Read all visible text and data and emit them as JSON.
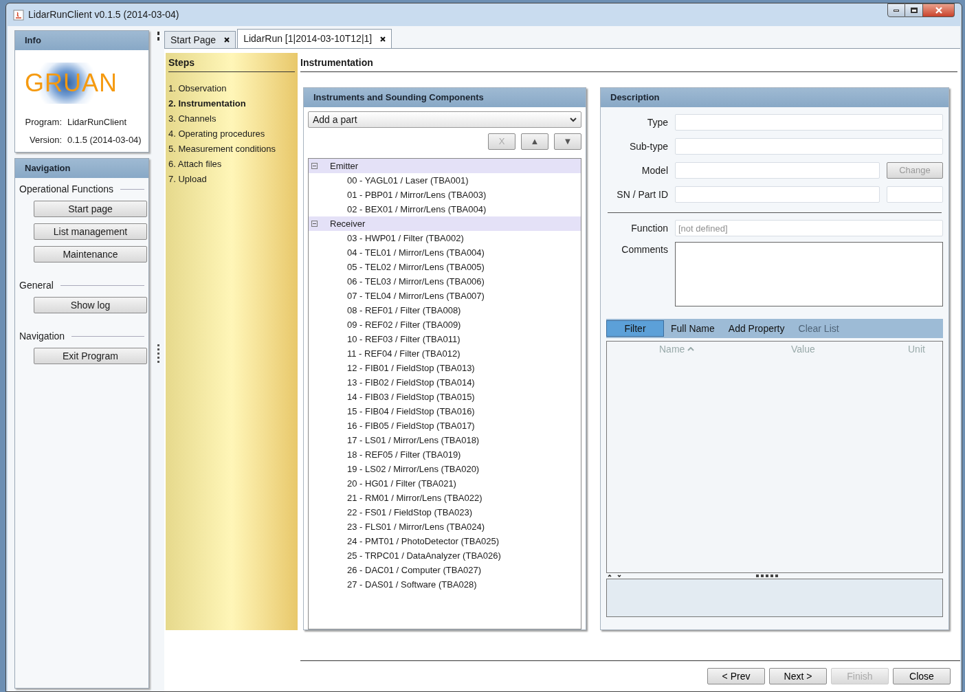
{
  "window": {
    "title": "LidarRunClient v0.1.5 (2014-03-04)"
  },
  "info": {
    "title": "Info",
    "logo_text": "GRUAN",
    "rows": [
      {
        "label": "Program:",
        "value": "LidarRunClient"
      },
      {
        "label": "Version:",
        "value": "0.1.5 (2014-03-04)"
      }
    ]
  },
  "navigation": {
    "title": "Navigation",
    "groups": [
      {
        "label": "Operational Functions",
        "buttons": [
          "Start page",
          "List management",
          "Maintenance"
        ]
      },
      {
        "label": "General",
        "buttons": [
          "Show log"
        ]
      },
      {
        "label": "Navigation",
        "buttons": [
          "Exit Program"
        ]
      }
    ]
  },
  "tabs": [
    {
      "label": "Start Page",
      "selected": false
    },
    {
      "label": "LidarRun [1|2014-03-10T12|1]",
      "selected": true
    }
  ],
  "steps": {
    "title": "Steps",
    "items": [
      {
        "label": "1. Observation",
        "selected": false
      },
      {
        "label": "2. Instrumentation",
        "selected": true
      },
      {
        "label": "3. Channels",
        "selected": false
      },
      {
        "label": "4. Operating procedures",
        "selected": false
      },
      {
        "label": "5. Measurement conditions",
        "selected": false
      },
      {
        "label": "6. Attach files",
        "selected": false
      },
      {
        "label": "7. Upload",
        "selected": false
      }
    ]
  },
  "page_title": "Instrumentation",
  "instruments": {
    "title": "Instruments and Sounding Components",
    "add_part": {
      "value": "Add a part"
    },
    "buttons": [
      {
        "label": "X",
        "disabled": true
      },
      {
        "label": "▲",
        "disabled": false
      },
      {
        "label": "▼",
        "disabled": false
      }
    ],
    "tree": [
      {
        "label": "Emitter",
        "expanded": true,
        "children": [
          {
            "label": "00 - YAGL01 / Laser (TBA001)"
          },
          {
            "label": "01 - PBP01 / Mirror/Lens (TBA003)"
          },
          {
            "label": "02 - BEX01 / Mirror/Lens (TBA004)"
          }
        ]
      },
      {
        "label": "Receiver",
        "expanded": true,
        "children": [
          {
            "label": "03 - HWP01 / Filter (TBA002)"
          },
          {
            "label": "04 - TEL01 / Mirror/Lens (TBA004)"
          },
          {
            "label": "05 - TEL02 / Mirror/Lens (TBA005)"
          },
          {
            "label": "06 - TEL03 / Mirror/Lens (TBA006)"
          },
          {
            "label": "07 - TEL04 / Mirror/Lens (TBA007)"
          },
          {
            "label": "08 - REF01 / Filter (TBA008)"
          },
          {
            "label": "09 - REF02 / Filter (TBA009)"
          },
          {
            "label": "10 - REF03 / Filter (TBA011)"
          },
          {
            "label": "11 - REF04 / Filter (TBA012)"
          },
          {
            "label": "12 - FIB01 / FieldStop (TBA013)"
          },
          {
            "label": "13 - FIB02 / FieldStop (TBA014)"
          },
          {
            "label": "14 - FIB03 / FieldStop (TBA015)"
          },
          {
            "label": "15 - FIB04 / FieldStop (TBA016)"
          },
          {
            "label": "16 - FIB05 / FieldStop (TBA017)"
          },
          {
            "label": "17 - LS01 / Mirror/Lens (TBA018)"
          },
          {
            "label": "18 - REF05 / Filter (TBA019)"
          },
          {
            "label": "19 - LS02 / Mirror/Lens (TBA020)"
          },
          {
            "label": "20 - HG01 / Filter (TBA021)"
          },
          {
            "label": "21 - RM01 / Mirror/Lens (TBA022)"
          },
          {
            "label": "22 - FS01 / FieldStop (TBA023)"
          },
          {
            "label": "23 - FLS01 / Mirror/Lens (TBA024)"
          },
          {
            "label": "24 - PMT01 / PhotoDetector (TBA025)"
          },
          {
            "label": "25 - TRPC01 / DataAnalyzer (TBA026)"
          },
          {
            "label": "26 - DAC01 / Computer (TBA027)"
          },
          {
            "label": "27 - DAS01 / Software (TBA028)"
          }
        ]
      }
    ]
  },
  "description": {
    "title": "Description",
    "fields": [
      {
        "label": "Type",
        "kind": "text"
      },
      {
        "label": "Sub-type",
        "kind": "text"
      },
      {
        "label": "Model",
        "kind": "text-button",
        "button": {
          "label": "Change",
          "disabled": true
        }
      },
      {
        "label": "SN / Part ID",
        "kind": "text-pair"
      },
      {
        "label": "Function",
        "kind": "text",
        "placeholder": "[not defined]"
      },
      {
        "label": "Comments",
        "kind": "area"
      }
    ],
    "toolbar": [
      {
        "label": "Filter",
        "selected": true,
        "disabled": false
      },
      {
        "label": "Full Name",
        "selected": false,
        "disabled": false
      },
      {
        "label": "Add Property",
        "selected": false,
        "disabled": false
      },
      {
        "label": "Clear List",
        "selected": false,
        "disabled": true
      }
    ],
    "columns": [
      {
        "label": "Name",
        "sorted": true
      },
      {
        "label": "Value",
        "sorted": false
      },
      {
        "label": "Unit",
        "sorted": false
      }
    ]
  },
  "footer_buttons": [
    {
      "label": "< Prev",
      "disabled": false
    },
    {
      "label": "Next >",
      "disabled": false
    },
    {
      "label": "Finish",
      "disabled": true
    },
    {
      "label": "Close",
      "disabled": false
    }
  ]
}
